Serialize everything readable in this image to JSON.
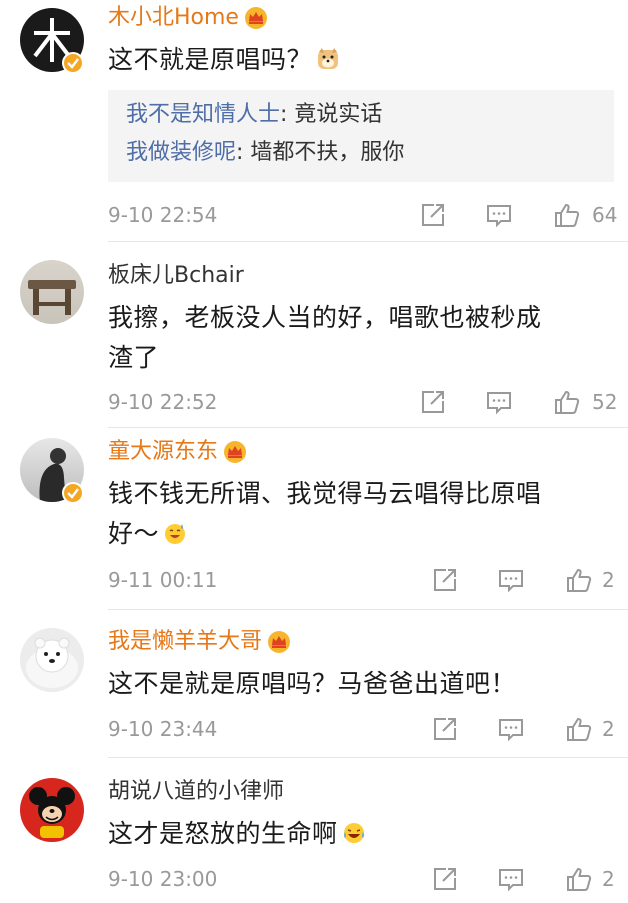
{
  "comments": [
    {
      "username": "木小北Home",
      "vip": true,
      "verified": true,
      "text": "这不就是原唱吗？",
      "emoji": "doge-emoji",
      "replies": [
        {
          "name": "我不是知情人士",
          "text": ": 竟说实话"
        },
        {
          "name": "我做装修呢",
          "text": ": 墙都不扶，服你"
        }
      ],
      "time": "9-10 22:54",
      "likes": "64"
    },
    {
      "username": "板床儿Bchair",
      "vip": false,
      "verified": false,
      "text_lines": [
        "我擦，老板没人当的好，唱歌也被秒成",
        "渣了"
      ],
      "time": "9-10 22:52",
      "likes": "52"
    },
    {
      "username": "童大源东东",
      "vip": true,
      "verified": true,
      "text_lines": [
        "钱不钱无所谓、我觉得马云唱得比原唱",
        "好～"
      ],
      "emoji": "sweat-smile-emoji",
      "time": "9-11 00:11",
      "likes": "2"
    },
    {
      "username": "我是懒羊羊大哥",
      "vip": true,
      "verified": false,
      "text": "这不是就是原唱吗？马爸爸出道吧！",
      "time": "9-10 23:44",
      "likes": "2"
    },
    {
      "username": "胡说八道的小律师",
      "vip": false,
      "verified": false,
      "text": "这才是怒放的生命啊",
      "emoji": "laugh-cry-emoji",
      "time": "9-10 23:00",
      "likes": "2"
    }
  ],
  "colors": {
    "vip_name": "#e67817",
    "reply_name": "#4f6ea8",
    "meta_gray": "#999999",
    "verified_badge": "#f5a623"
  }
}
